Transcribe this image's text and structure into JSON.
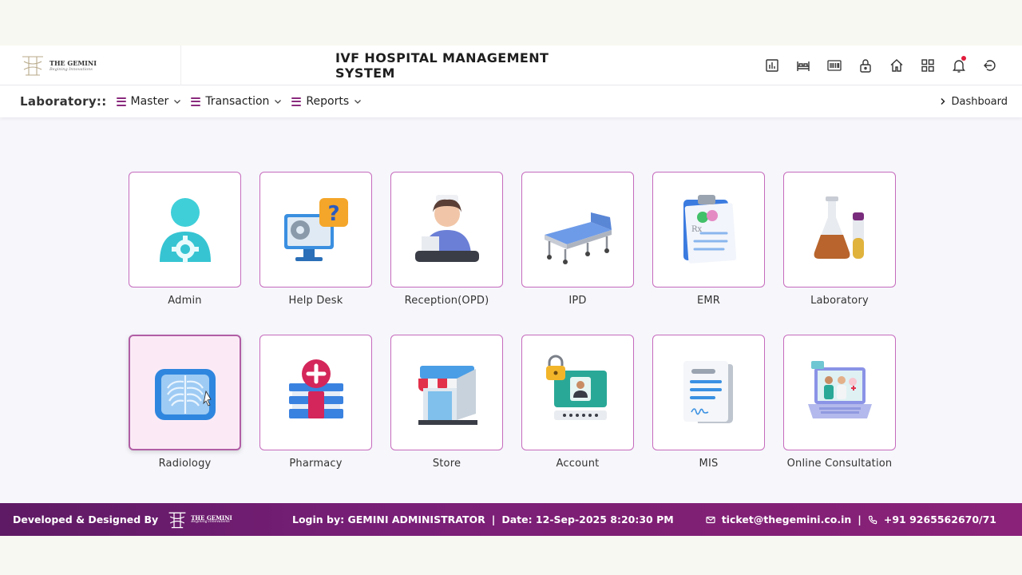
{
  "header": {
    "logo_name": "THE GEMINI",
    "logo_tagline": "Begining Innovations",
    "title": "IVF HOSPITAL MANAGEMENT SYSTEM",
    "icons": [
      "bar-chart-icon",
      "bed-icon",
      "barcode-icon",
      "lock-icon",
      "home-icon",
      "grid-icon",
      "bell-icon",
      "logout-icon"
    ]
  },
  "menubar": {
    "module_label": "Laboratory::",
    "menus": [
      {
        "label": "Master"
      },
      {
        "label": "Transaction"
      },
      {
        "label": "Reports"
      }
    ],
    "dashboard_label": "Dashboard"
  },
  "tiles": [
    {
      "label": "Admin",
      "icon": "admin-icon"
    },
    {
      "label": "Help Desk",
      "icon": "help-desk-icon"
    },
    {
      "label": "Reception(OPD)",
      "icon": "reception-icon"
    },
    {
      "label": "IPD",
      "icon": "hospital-bed-icon"
    },
    {
      "label": "EMR",
      "icon": "clipboard-icon"
    },
    {
      "label": "Laboratory",
      "icon": "flask-icon"
    },
    {
      "label": "Radiology",
      "icon": "xray-icon"
    },
    {
      "label": "Pharmacy",
      "icon": "pharmacy-icon"
    },
    {
      "label": "Store",
      "icon": "store-icon"
    },
    {
      "label": "Account",
      "icon": "account-icon"
    },
    {
      "label": "MIS",
      "icon": "report-document-icon"
    },
    {
      "label": "Online Consultation",
      "icon": "laptop-consult-icon"
    }
  ],
  "footer": {
    "developed_by": "Developed & Designed By",
    "logo_name": "THE GEMINI",
    "logo_tagline": "Begining Innovations",
    "login_text": "Login by: GEMINI ADMINISTRATOR",
    "separator": "|",
    "date_text": "Date: 12-Sep-2025 8:20:30 PM",
    "email": "ticket@thegemini.co.in",
    "phone": "+91 9265562670/71"
  },
  "colors": {
    "accent": "#8a2b7e",
    "tile_border": "#c66bbd",
    "footer_start": "#5e1a64",
    "footer_end": "#8a2279"
  }
}
